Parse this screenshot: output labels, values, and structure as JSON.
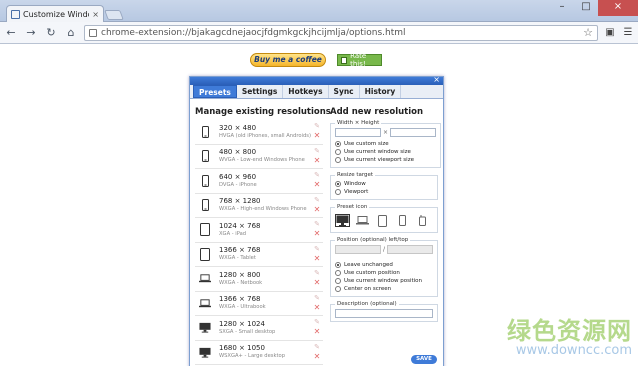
{
  "browser": {
    "tab_title": "Customize Window Resiz",
    "tab_close": "×",
    "url": "chrome-extension://bjakagcdnejaocjfdgmkgckjhcijmlja/options.html",
    "win_min": "–",
    "win_max": "□",
    "win_close": "×"
  },
  "promo": {
    "coffee_label": "Buy me a coffee",
    "rate_label": "Rate this!"
  },
  "dialog": {
    "close_label": "×",
    "tabs": [
      "Presets",
      "Settings",
      "Hotkeys",
      "Sync",
      "History"
    ],
    "left_title": "Manage existing resolutions",
    "right_title": "Add new resolution",
    "presets": [
      {
        "size": "320 × 480",
        "desc": "HVGA (old iPhones, small Androids)",
        "icon": "phone"
      },
      {
        "size": "480 × 800",
        "desc": "WVGA - Low-end Windows Phone",
        "icon": "phone"
      },
      {
        "size": "640 × 960",
        "desc": "DVGA - iPhone",
        "icon": "phone"
      },
      {
        "size": "768 × 1280",
        "desc": "WXGA - High-end Windows Phone",
        "icon": "phone"
      },
      {
        "size": "1024 × 768",
        "desc": "XGA - iPad",
        "icon": "tablet"
      },
      {
        "size": "1366 × 768",
        "desc": "WXGA - Tablet",
        "icon": "tablet"
      },
      {
        "size": "1280 × 800",
        "desc": "WXGA - Netbook",
        "icon": "laptop"
      },
      {
        "size": "1366 × 768",
        "desc": "WXGA - Ultrabook",
        "icon": "laptop"
      },
      {
        "size": "1280 × 1024",
        "desc": "SXGA - Small desktop",
        "icon": "desktop"
      },
      {
        "size": "1680 × 1050",
        "desc": "WSXGA+ - Large desktop",
        "icon": "desktop"
      }
    ],
    "form": {
      "wh_legend": "Width × Height",
      "times": "×",
      "size_options": [
        "Use custom size",
        "Use current window size",
        "Use current viewport size"
      ],
      "resize_legend": "Resize target",
      "resize_options": [
        "Window",
        "Viewport"
      ],
      "icon_legend": "Preset icon",
      "position_legend": "Position",
      "position_hint": "(optional) left/top",
      "slash": "/",
      "position_options": [
        "Leave unchanged",
        "Use custom position",
        "Use current window position",
        "Center on screen"
      ],
      "desc_legend": "Description",
      "desc_hint": "(optional)",
      "save_label": "SAVE"
    }
  },
  "watermark": {
    "cn": "绿色资源网",
    "url": "www.downcc.com"
  },
  "colors": {
    "accent": "#3f7bd8",
    "delete": "#e26a6a"
  }
}
